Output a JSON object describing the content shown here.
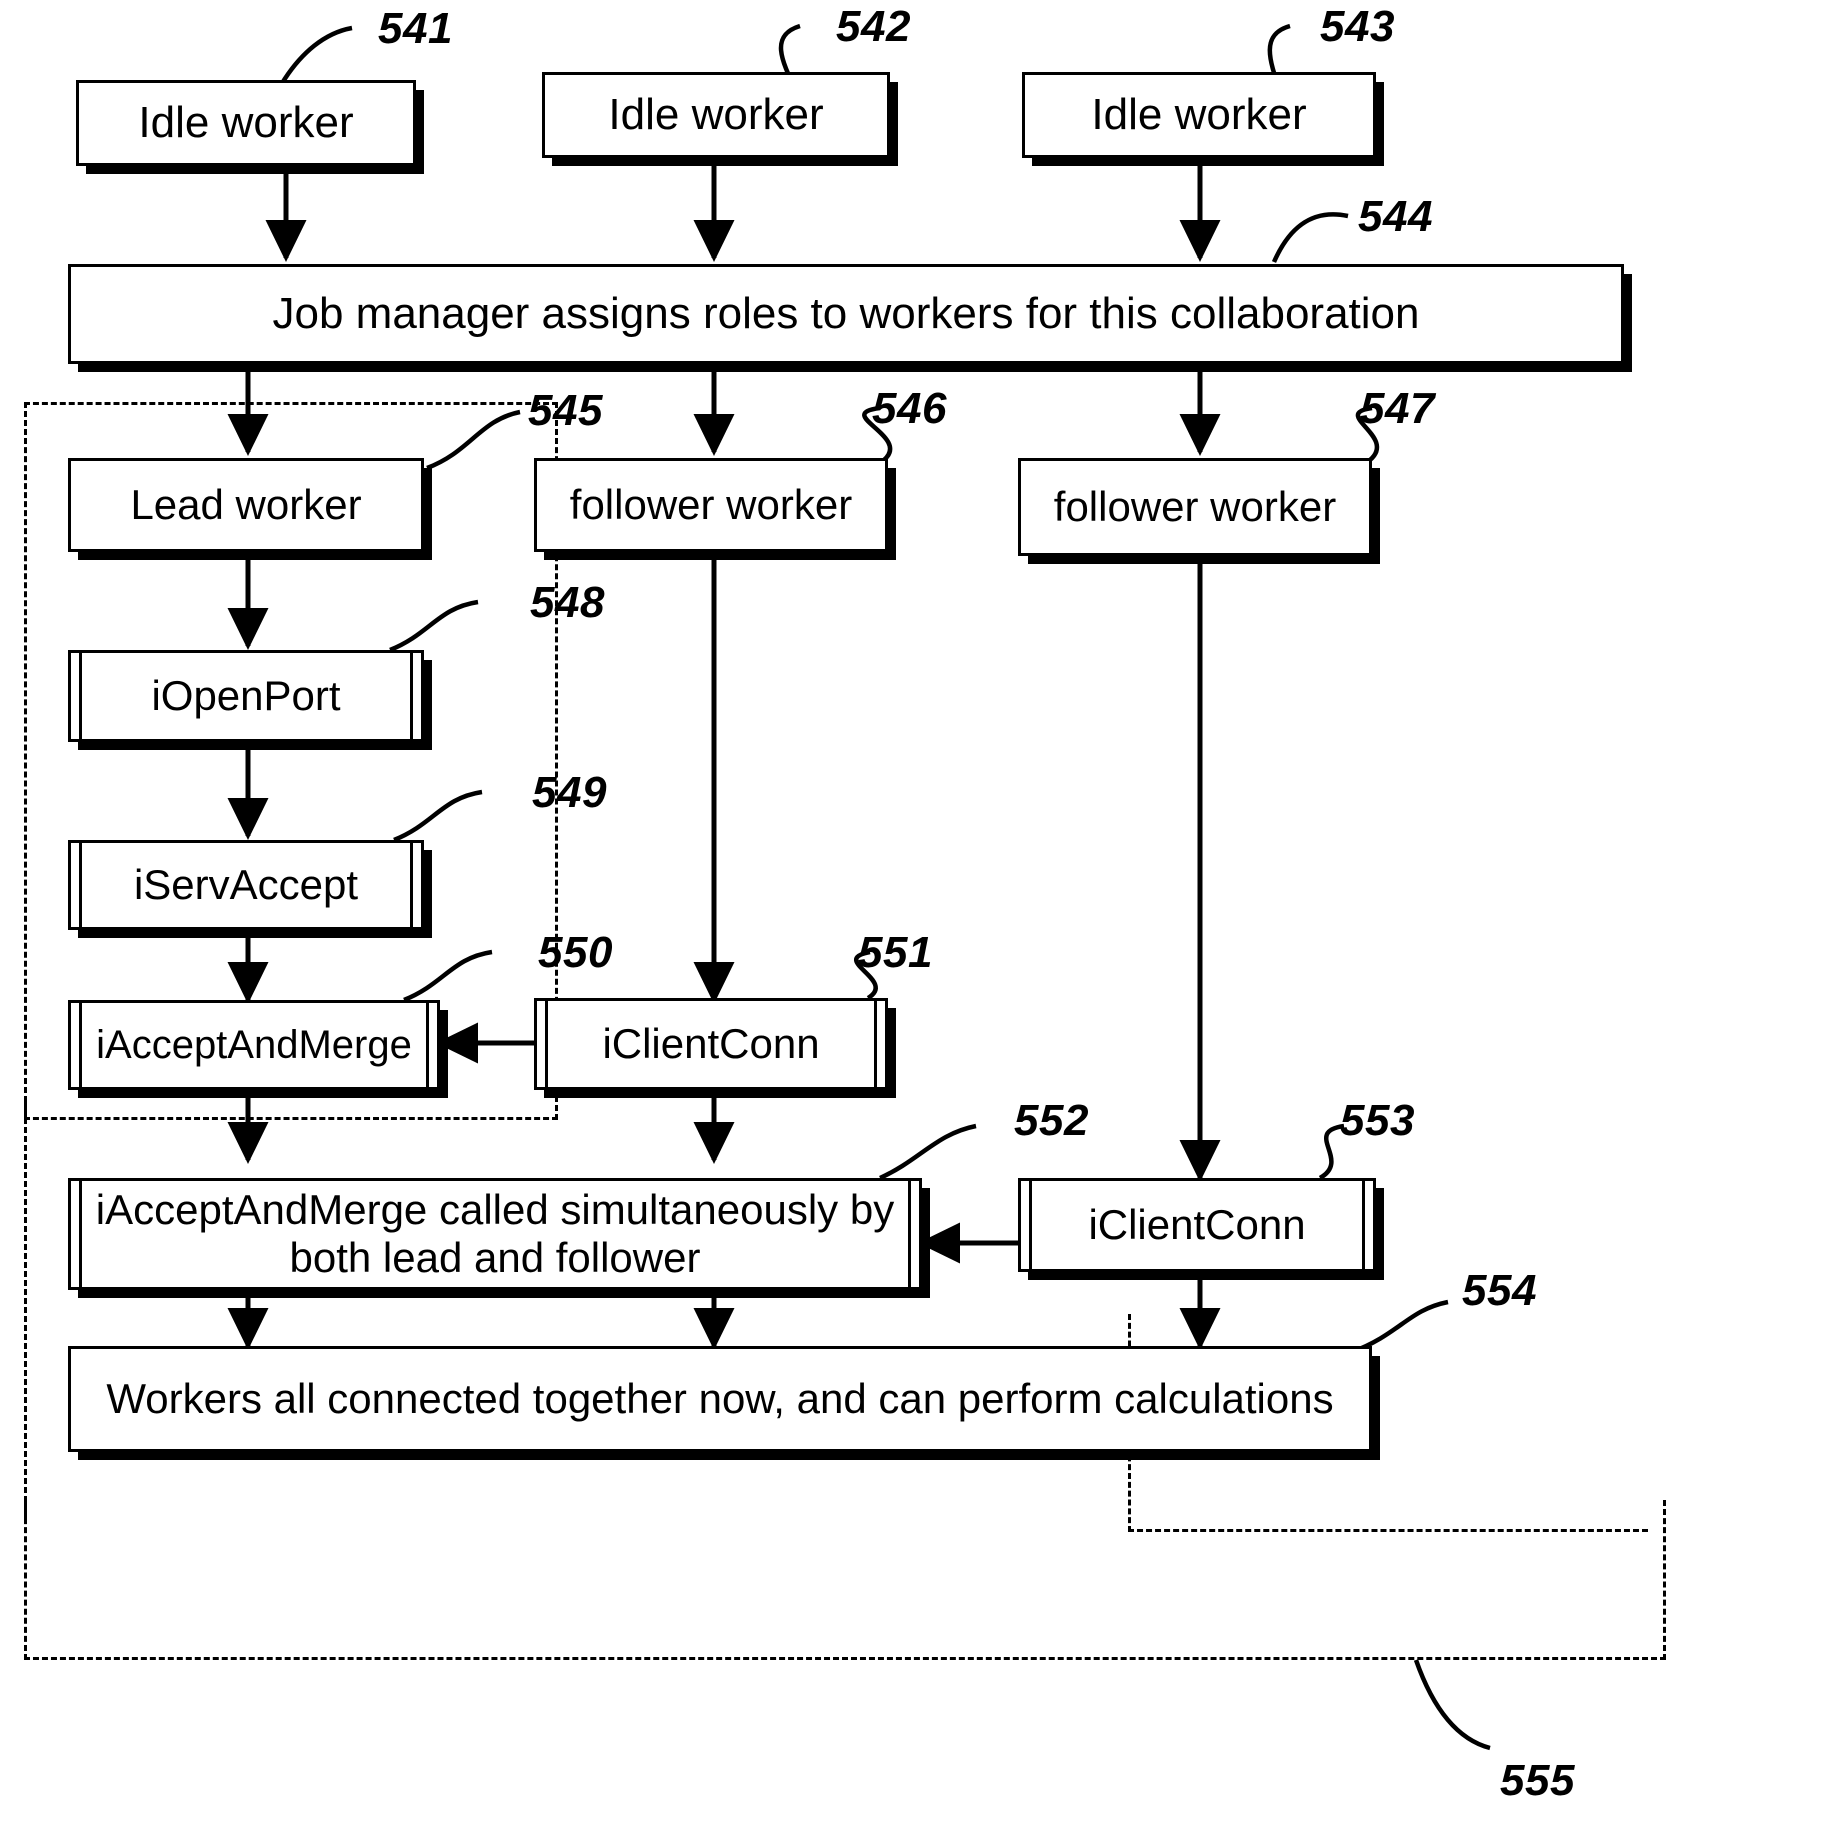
{
  "figure": {
    "type": "patent-flowchart",
    "background": "#ffffff",
    "line_color": "#000000"
  },
  "nodes": [
    {
      "id": "n541",
      "label": "Idle worker",
      "ref": "541",
      "shape": "process"
    },
    {
      "id": "n542",
      "label": "Idle worker",
      "ref": "542",
      "shape": "process"
    },
    {
      "id": "n543",
      "label": "Idle worker",
      "ref": "543",
      "shape": "process"
    },
    {
      "id": "n544",
      "label": "Job manager assigns roles to workers for this collaboration",
      "ref": "544",
      "shape": "process"
    },
    {
      "id": "n545",
      "label": "Lead worker",
      "ref": "545",
      "shape": "process"
    },
    {
      "id": "n546",
      "label": "follower worker",
      "ref": "546",
      "shape": "process"
    },
    {
      "id": "n547",
      "label": "follower worker",
      "ref": "547",
      "shape": "process"
    },
    {
      "id": "n548",
      "label": "iOpenPort",
      "ref": "548",
      "shape": "subroutine"
    },
    {
      "id": "n549",
      "label": "iServAccept",
      "ref": "549",
      "shape": "subroutine"
    },
    {
      "id": "n550",
      "label": "iAcceptAndMerge",
      "ref": "550",
      "shape": "subroutine"
    },
    {
      "id": "n551",
      "label": "iClientConn",
      "ref": "551",
      "shape": "subroutine"
    },
    {
      "id": "n552",
      "label": "iAcceptAndMerge called simultaneously by\nboth lead and follower",
      "ref": "552",
      "shape": "subroutine"
    },
    {
      "id": "n553",
      "label": "iClientConn",
      "ref": "553",
      "shape": "subroutine"
    },
    {
      "id": "n554",
      "label": "Workers all connected together now, and can perform calculations",
      "ref": "554",
      "shape": "process"
    }
  ],
  "regions": [
    {
      "id": "r_lead",
      "ref": "545",
      "style": "dashed"
    },
    {
      "id": "r_mid",
      "ref": "552",
      "style": "dashed"
    },
    {
      "id": "r_outer",
      "ref": "555",
      "style": "dashed"
    }
  ],
  "refs": {
    "r541": "541",
    "r542": "542",
    "r543": "543",
    "r544": "544",
    "r545": "545",
    "r546": "546",
    "r547": "547",
    "r548": "548",
    "r549": "549",
    "r550": "550",
    "r551": "551",
    "r552": "552",
    "r553": "553",
    "r554": "554",
    "r555": "555"
  },
  "labels": {
    "idle_worker_1": "Idle worker",
    "idle_worker_2": "Idle worker",
    "idle_worker_3": "Idle worker",
    "job_manager": "Job manager assigns roles to workers for this collaboration",
    "lead_worker": "Lead worker",
    "follower_worker_1": "follower worker",
    "follower_worker_2": "follower worker",
    "iopenport": "iOpenPort",
    "iservaccept": "iServAccept",
    "iacceptandmerge": "iAcceptAndMerge",
    "iclientconn_1": "iClientConn",
    "iacceptandmerge_both": "iAcceptAndMerge called simultaneously by\nboth lead and follower",
    "iclientconn_2": "iClientConn",
    "workers_connected": "Workers all connected together now, and can perform calculations"
  },
  "edges": [
    {
      "from": "n541",
      "to": "n544",
      "kind": "arrow",
      "direction": "down"
    },
    {
      "from": "n542",
      "to": "n544",
      "kind": "arrow",
      "direction": "down"
    },
    {
      "from": "n543",
      "to": "n544",
      "kind": "arrow",
      "direction": "down"
    },
    {
      "from": "n544",
      "to": "n545",
      "kind": "arrow",
      "direction": "down"
    },
    {
      "from": "n544",
      "to": "n546",
      "kind": "arrow",
      "direction": "down"
    },
    {
      "from": "n544",
      "to": "n547",
      "kind": "arrow",
      "direction": "down"
    },
    {
      "from": "n545",
      "to": "n548",
      "kind": "arrow",
      "direction": "down"
    },
    {
      "from": "n548",
      "to": "n549",
      "kind": "arrow",
      "direction": "down"
    },
    {
      "from": "n549",
      "to": "n550",
      "kind": "arrow",
      "direction": "down"
    },
    {
      "from": "n546",
      "to": "n551",
      "kind": "arrow",
      "direction": "down"
    },
    {
      "from": "n551",
      "to": "n550",
      "kind": "arrow",
      "direction": "left"
    },
    {
      "from": "n550",
      "to": "n552",
      "kind": "arrow",
      "direction": "down"
    },
    {
      "from": "n551",
      "to": "n552",
      "kind": "arrow",
      "direction": "down"
    },
    {
      "from": "n547",
      "to": "n553",
      "kind": "arrow",
      "direction": "down"
    },
    {
      "from": "n553",
      "to": "n552",
      "kind": "arrow",
      "direction": "left"
    },
    {
      "from": "n552",
      "to": "n554",
      "kind": "arrow",
      "direction": "down"
    },
    {
      "from": "n553",
      "to": "n554",
      "kind": "arrow",
      "direction": "down"
    }
  ]
}
